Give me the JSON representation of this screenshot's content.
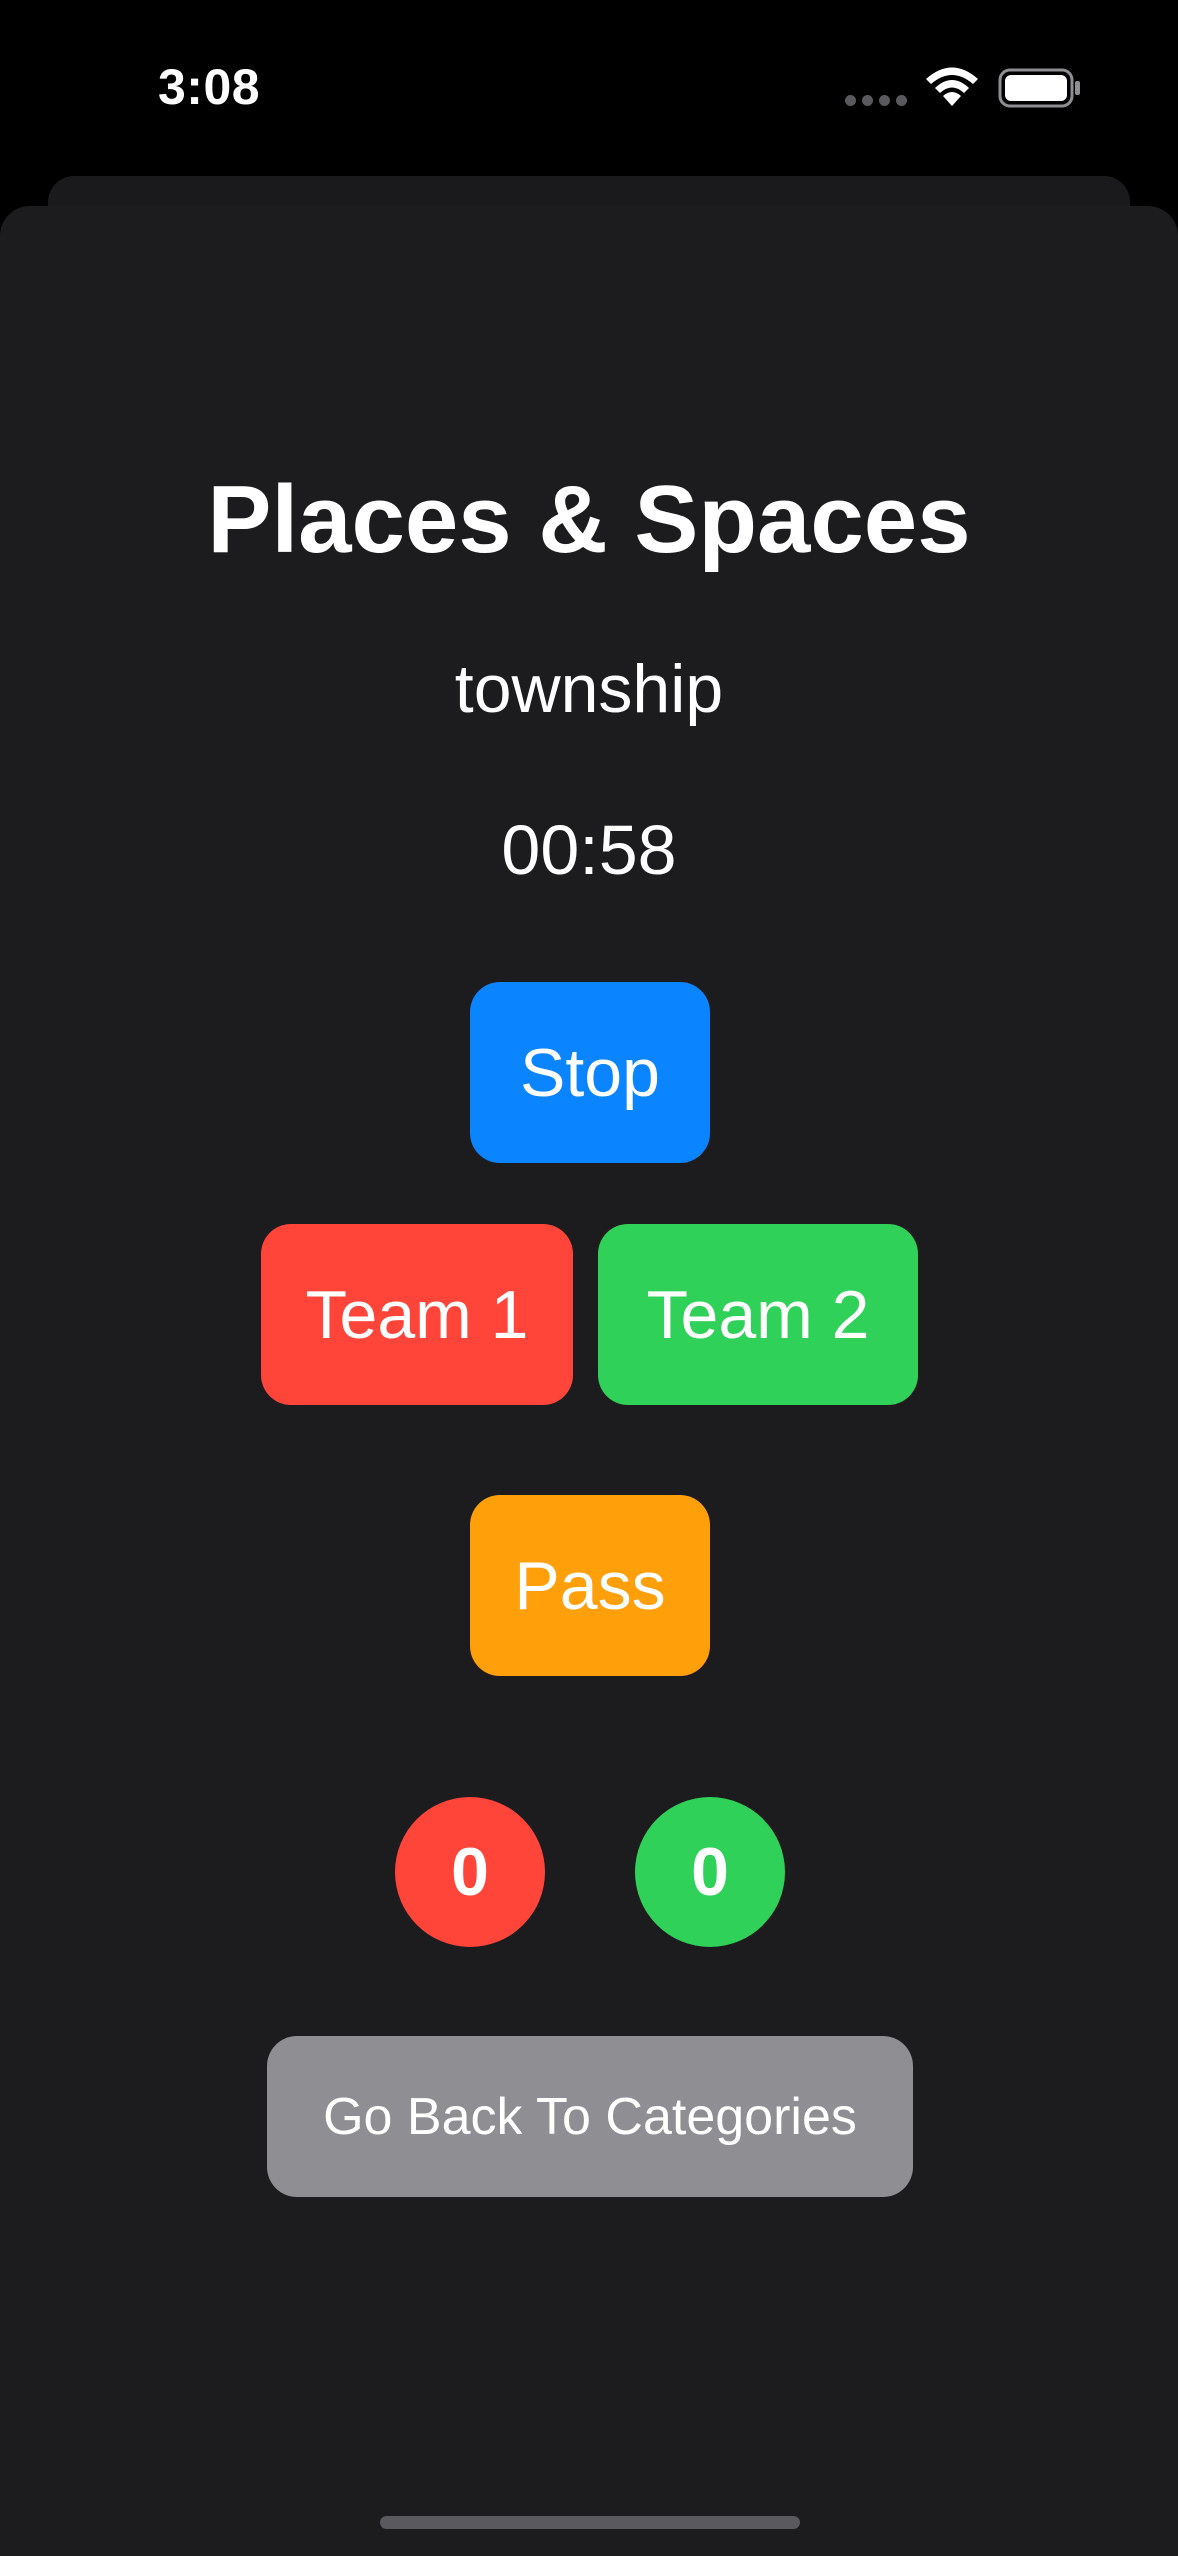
{
  "status_bar": {
    "time": "3:08",
    "icons": [
      "signal-dots-icon",
      "wifi-icon",
      "battery-icon"
    ]
  },
  "game": {
    "category_title": "Places & Spaces",
    "current_word": "township",
    "timer": "00:58"
  },
  "buttons": {
    "stop": "Stop",
    "team1": "Team 1",
    "team2": "Team 2",
    "pass": "Pass",
    "back": "Go Back To Categories"
  },
  "scores": {
    "team1": "0",
    "team2": "0"
  },
  "colors": {
    "background": "#1c1c1e",
    "stop": "#0a84ff",
    "team1": "#ff453a",
    "team2": "#30d158",
    "pass": "#ff9f0a",
    "back": "#8e8e93"
  }
}
